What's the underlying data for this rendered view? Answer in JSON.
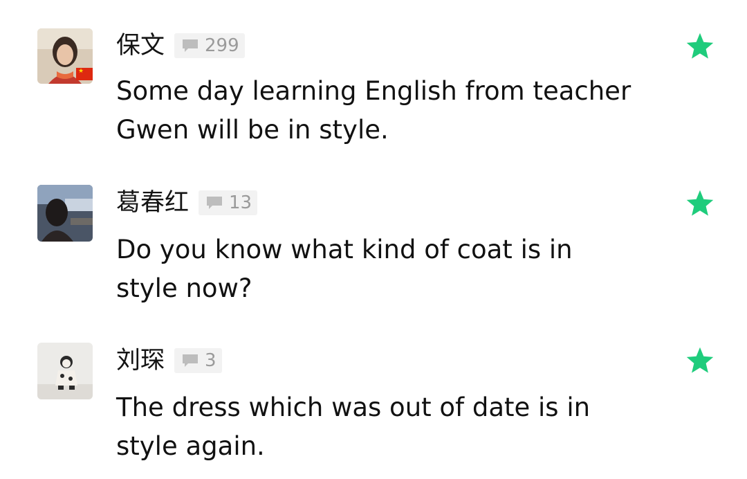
{
  "comments": [
    {
      "name": "保文",
      "count": "299",
      "text_line1": "Some day learning English from teacher",
      "text_line2": "Gwen will be in style.",
      "has_flag": true
    },
    {
      "name": "葛春红",
      "count": "13",
      "text_line1": "Do you know what kind of coat is in",
      "text_line2": "style now?"
    },
    {
      "name": "刘琛",
      "count": "3",
      "text_line1": "The dress which was out of date is in",
      "text_line2": "style again."
    }
  ],
  "icons": {
    "comment_count": "speech-bubble-icon",
    "favorite": "star-icon",
    "flag": "china-flag-icon"
  },
  "colors": {
    "star": "#1fcc7c",
    "count_text": "#9a9a9a",
    "badge_bg": "#f2f2f2",
    "flag": "#de2910"
  }
}
